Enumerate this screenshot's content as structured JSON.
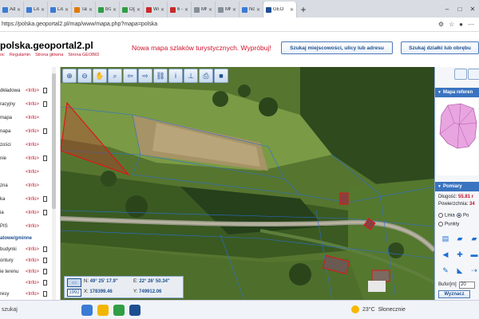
{
  "browser": {
    "tabs": [
      {
        "label": "Adres",
        "color": "#3a7bd5"
      },
      {
        "label": "Lista",
        "color": "#3a7bd5"
      },
      {
        "label": "Lista",
        "color": "#3a7bd5"
      },
      {
        "label": "Tablic",
        "color": "#e07a00"
      },
      {
        "label": "brzo",
        "color": "#2f9e44"
      },
      {
        "label": "Ogło",
        "color": "#2f9e44"
      },
      {
        "label": "Wirtu",
        "color": "#c92a2a"
      },
      {
        "label": "6 - W",
        "color": "#c92a2a"
      },
      {
        "label": "MMS",
        "color": "#868e96"
      },
      {
        "label": "MMS",
        "color": "#868e96"
      },
      {
        "label": "Now",
        "color": "#3a7bd5"
      },
      {
        "label": "GEO",
        "color": "#1d4f91",
        "active": true
      }
    ],
    "new_tab": "+",
    "url": "https://polska.geoportal2.pl/map/www/mapa.php?mapa=polska",
    "window_controls": [
      "–",
      "□",
      "✕"
    ]
  },
  "header": {
    "title": "polska.geoportal2.pl",
    "links": [
      "oc",
      "Regulamin",
      "Strona główna",
      "Strona GEOBID"
    ],
    "promo": "Nowa mapa szlaków turystycznych. Wypróbuj!",
    "search_address_button": "Szukaj miejscowości, ulicy lub adresu",
    "search_parcel_button": "Szukaj działki lub obrębu"
  },
  "layers": [
    {
      "name": "dkładowa",
      "info": "<Info>",
      "doc": true
    },
    {
      "name": "racyjny",
      "info": "<Info>",
      "doc": true
    },
    {
      "name": "mapa",
      "info": "<Info>",
      "doc": false
    },
    {
      "name": "napa",
      "info": "<Info>",
      "doc": true
    },
    {
      "name": "zości",
      "info": "<Info>",
      "doc": false
    },
    {
      "name": "nie",
      "info": "<Info>",
      "doc": true
    },
    {
      "name": "",
      "info": "<Info>",
      "doc": false
    },
    {
      "name": "zna",
      "info": "<Info>",
      "doc": false
    },
    {
      "name": "ka",
      "info": "<Info>",
      "doc": true
    },
    {
      "name": "ia",
      "info": "<Info>",
      "doc": true
    },
    {
      "name": "PIS",
      "info": "<Info>",
      "doc": false
    }
  ],
  "layers_section": "atowe/gminne",
  "layers2": [
    {
      "name": "budynki",
      "info": "<Info>",
      "doc": true
    },
    {
      "name": "ontury",
      "info": "<Info>",
      "doc": true
    },
    {
      "name": "ie terenu",
      "info": "<Info>",
      "doc": true
    },
    {
      "name": "",
      "info": "<Info>",
      "doc": true
    },
    {
      "name": "resy",
      "info": "<Info>",
      "doc": true
    },
    {
      "name": "lanowanie",
      "info": "<Info>",
      "doc": false
    }
  ],
  "left_footer": [
    "ności i",
    "ości"
  ],
  "toolbar": {
    "tools": [
      "zoom-in",
      "zoom-out",
      "pan",
      "zoom-window",
      "back",
      "forward",
      "link",
      "info",
      "measure",
      "print",
      "camera"
    ],
    "glyphs": [
      "⊕",
      "⊖",
      "✋",
      "⌕",
      "⇦",
      "⇨",
      "⛓",
      "i",
      "⊥",
      "⎙",
      "■"
    ]
  },
  "coords": {
    "year": "1992",
    "n_label": "N:",
    "n_value": "49° 25' 17.9\"",
    "e_label": "E:",
    "e_value": "22° 26' 50.34\"",
    "x_label": "X:",
    "x_value": "178399.46",
    "y_label": "Y:",
    "y_value": "749912.06"
  },
  "right_panel": {
    "reference_map_title": "Mapa referen",
    "measurements_title": "Pomiary",
    "length_label": "Długość:",
    "length_value": "55.81 r",
    "area_label": "Powierzchnia:",
    "area_value": "34",
    "opt_line": "Linia",
    "opt_polygon": "Po",
    "opt_points": "Punkty",
    "buffer_label": "Bufor[m]",
    "buffer_value": "20",
    "determine_button": "Wyznacz"
  },
  "taskbar": {
    "search": "szukaj",
    "temperature": "23°C",
    "weather": "Słonecznie",
    "icons": [
      "#3a7bd5",
      "#f2b600",
      "#2f9e44",
      "#1d4f91"
    ]
  }
}
